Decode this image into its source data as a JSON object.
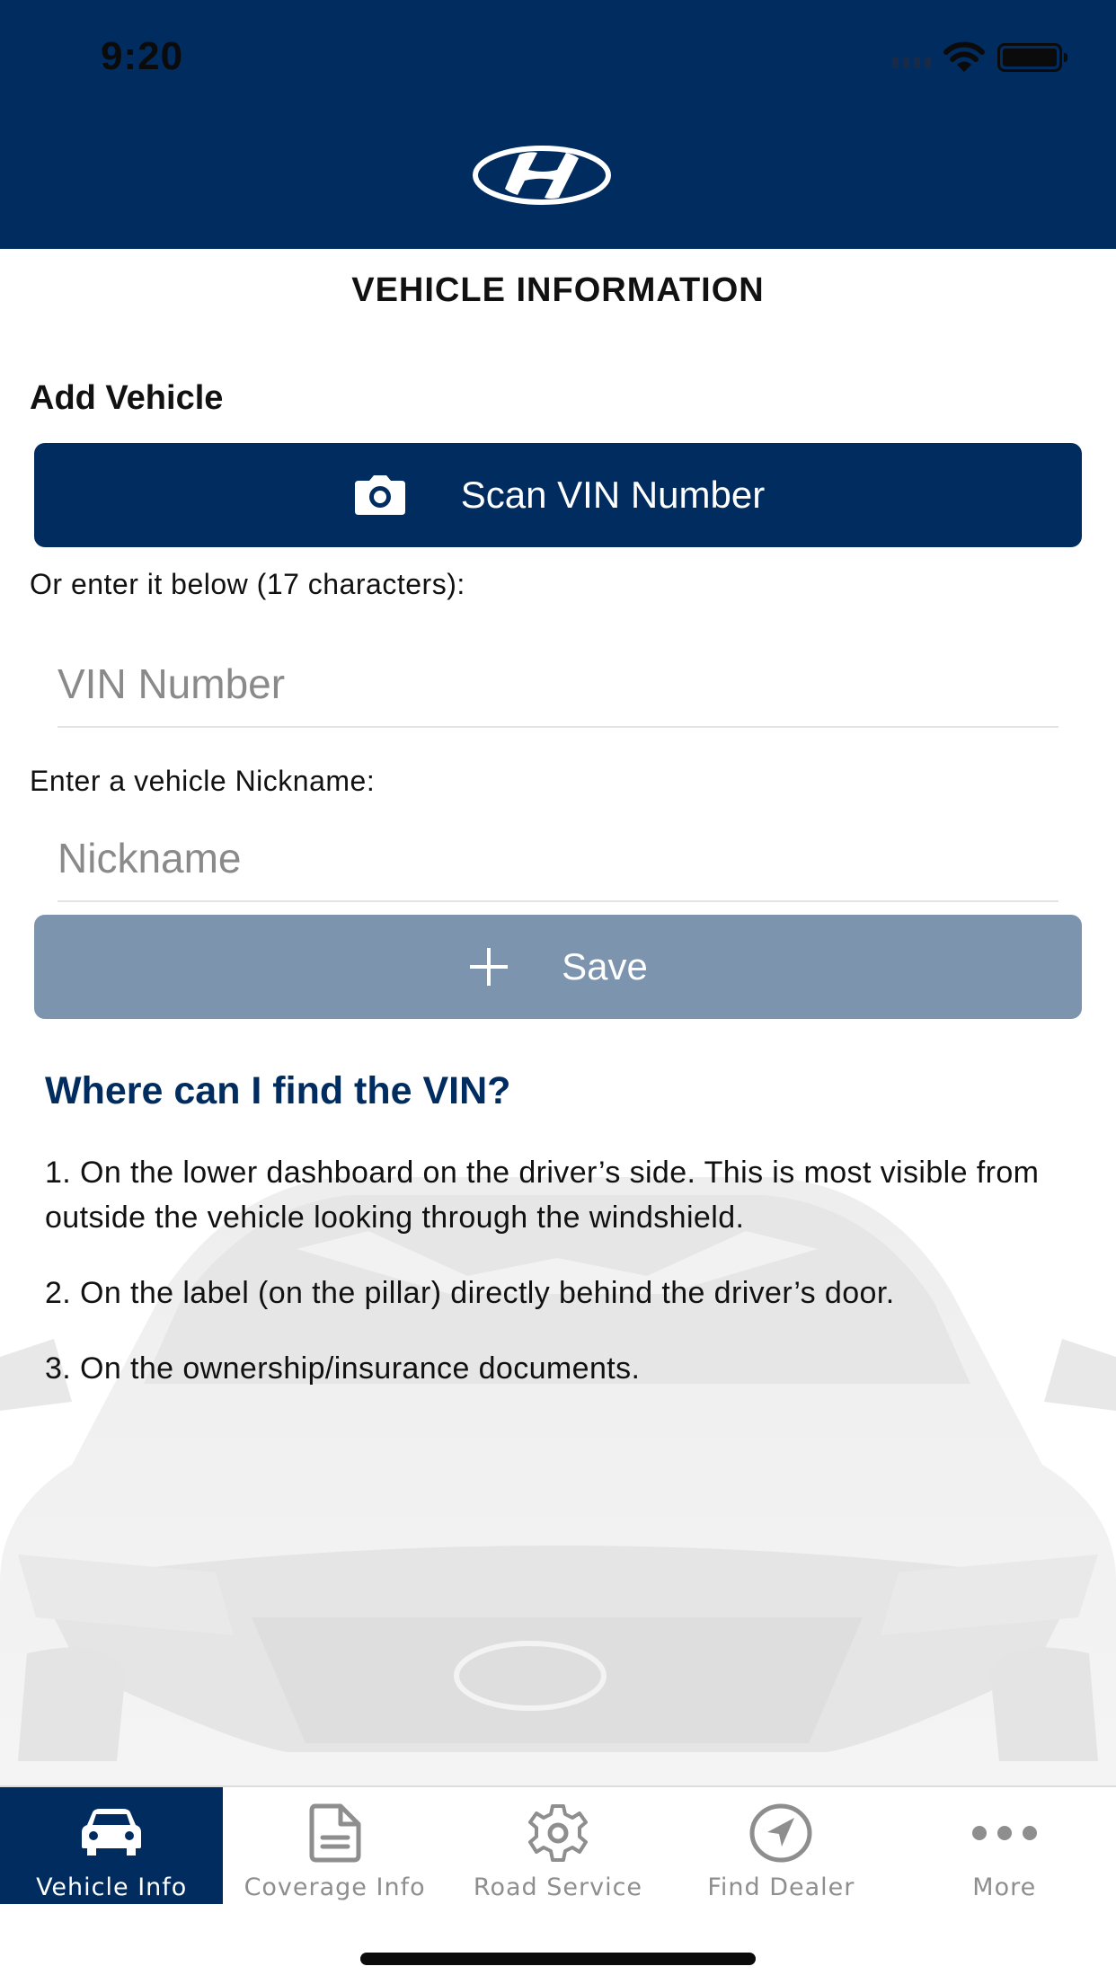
{
  "status_bar": {
    "time": "9:20"
  },
  "header": {
    "brand": "Hyundai"
  },
  "page": {
    "title": "VEHICLE INFORMATION"
  },
  "add_vehicle": {
    "section_label": "Add Vehicle",
    "scan_button_label": "Scan VIN Number",
    "vin_hint": "Or enter it below (17 characters):",
    "vin_input": {
      "value": "",
      "placeholder": "VIN Number"
    },
    "nickname_hint": "Enter a vehicle Nickname:",
    "nickname_input": {
      "value": "",
      "placeholder": "Nickname"
    },
    "save_button_label": "Save"
  },
  "help": {
    "title": "Where can I find the VIN?",
    "items": [
      "1. On the lower dashboard on the driver’s side. This is most visible from outside the vehicle looking through the windshield.",
      "2. On the label (on the pillar) directly behind the driver’s door.",
      "3. On the ownership/insurance documents."
    ]
  },
  "tabbar": {
    "items": [
      {
        "label": "Vehicle Info",
        "icon": "car-icon",
        "active": true
      },
      {
        "label": "Coverage Info",
        "icon": "document-icon",
        "active": false
      },
      {
        "label": "Road Service",
        "icon": "gear-icon",
        "active": false
      },
      {
        "label": "Find Dealer",
        "icon": "navigation-icon",
        "active": false
      },
      {
        "label": "More",
        "icon": "more-icon",
        "active": false
      }
    ]
  },
  "colors": {
    "brand_navy": "#002c5f",
    "save_disabled": "#7c94ad",
    "tab_inactive": "#8e8e8e"
  }
}
